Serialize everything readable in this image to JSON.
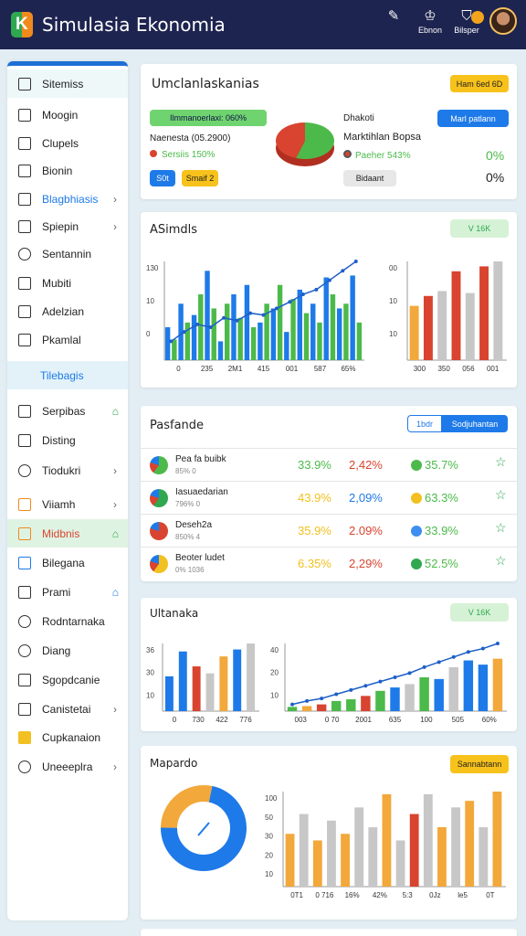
{
  "app": {
    "title": "Simulasia Ekonomia"
  },
  "topbar": {
    "items": [
      {
        "label": "",
        "icon": "puzzle-icon"
      },
      {
        "label": "Ebnon",
        "icon": "trophy-icon"
      },
      {
        "label": "Bilsper",
        "icon": "shield-icon"
      }
    ]
  },
  "sidebar": {
    "items": [
      {
        "label": "Sitemiss",
        "icon": "doc-icon",
        "active": true
      },
      {
        "label": "Moogin",
        "icon": "edit-icon"
      },
      {
        "label": "Clupels",
        "icon": "doc-icon"
      },
      {
        "label": "Bionin",
        "icon": "screen-icon"
      },
      {
        "label": "Blagbhiasis",
        "icon": "screen-icon",
        "arrow": true,
        "blue": true
      },
      {
        "label": "Spiepin",
        "icon": "grid-icon",
        "arrow": true
      },
      {
        "label": "Sentannin",
        "icon": "link-icon"
      },
      {
        "label": "Mubiti",
        "icon": "doc-icon"
      },
      {
        "label": "Adelzian",
        "icon": "doc-icon"
      },
      {
        "label": "Pkamlal",
        "icon": "doc-icon"
      },
      {
        "label": "Tilebagis",
        "icon": "none",
        "section": true
      },
      {
        "label": "Serpibas",
        "icon": "doc-icon",
        "house": true
      },
      {
        "label": "Disting",
        "icon": "doc-icon"
      },
      {
        "label": "Tiodukri",
        "icon": "link-icon",
        "arrow": true
      },
      {
        "label": "Viiamh",
        "icon": "orange-icon",
        "arrow": true
      },
      {
        "label": "Midbnis",
        "icon": "orange-icon",
        "house": true,
        "highlight": true
      },
      {
        "label": "Bilegana",
        "icon": "blue-icon"
      },
      {
        "label": "Prami",
        "icon": "doc-icon",
        "house": true
      },
      {
        "label": "Rodntarnaka",
        "icon": "search-icon"
      },
      {
        "label": "Diang",
        "icon": "gear-icon"
      },
      {
        "label": "Sgopdcanie",
        "icon": "doc-icon"
      },
      {
        "label": "Canistetai",
        "icon": "doc-icon",
        "arrow": true
      },
      {
        "label": "Cupkanaion",
        "icon": "yellow-icon"
      },
      {
        "label": "Uneeeplra",
        "icon": "heart-icon",
        "arrow": true
      }
    ]
  },
  "summary": {
    "title": "Umclanlaskanias",
    "button": "Ham 6ed 6D",
    "green_badge": "Ilmmanoerlaxi: 060%",
    "label1": "Naenesta (05.2900)",
    "label2": "Sersiis 150%",
    "btn1": "S0t",
    "btn2": "Smaif 2",
    "right_title": "Dhakoti",
    "right_button": "Marl patlann",
    "right_sub": "Marktihlan Bopsa",
    "right_line": "Paeher 543%",
    "stat1": "0%",
    "stat2": "0%",
    "pill": "Bidaant",
    "pie": [
      {
        "value": 55,
        "color": "#4cba4a"
      },
      {
        "value": 45,
        "color": "#d8442f"
      }
    ]
  },
  "asimdls": {
    "title": "ASimdls",
    "badge": "V 16K",
    "left_chart": {
      "type": "bar",
      "categories": [
        "0",
        "235",
        "2M1",
        "415",
        "001",
        "587",
        "65%"
      ],
      "series": [
        {
          "values": [
            35,
            60,
            48,
            95,
            20,
            70,
            80,
            40,
            55,
            30,
            75,
            60,
            88,
            55,
            90
          ],
          "color": "#1e7ae8"
        },
        {
          "values": [
            22,
            40,
            70,
            55,
            60,
            45,
            35,
            60,
            80,
            65,
            50,
            40,
            70,
            60,
            40
          ],
          "color": "#4cba4a"
        }
      ],
      "line": [
        20,
        30,
        38,
        35,
        45,
        42,
        50,
        48,
        55,
        62,
        70,
        75,
        85,
        95,
        105
      ],
      "ylabels": [
        "130",
        "10",
        "0"
      ]
    },
    "right_chart": {
      "type": "bar",
      "categories": [
        "300",
        "350",
        "056",
        "001"
      ],
      "values": [
        55,
        65,
        70,
        90,
        68,
        95,
        100
      ],
      "colors": [
        "#f2a83a",
        "#d8442f",
        "#c7c7c7",
        "#d8442f",
        "#c7c7c7",
        "#d8442f",
        "#c7c7c7"
      ],
      "ylabels": [
        "00",
        "10",
        "10"
      ]
    }
  },
  "pasfande": {
    "title": "Pasfande",
    "tab1": "1bdr",
    "tab2": "Sodjuhantan",
    "rows": [
      {
        "name": "Pea fa buibk",
        "sub": "85% 0",
        "v1": "33.9%",
        "v2": "2,42%",
        "v3": "35.7%",
        "dot": "#4cba4a",
        "icon": "#4cba4a",
        "c1": "#4cba4a",
        "c2": "#d8442f",
        "c3": "#4cba4a"
      },
      {
        "name": "Iasuaedarian",
        "sub": "796% 0",
        "v1": "43.9%",
        "v2": "2,09%",
        "v3": "63.3%",
        "dot": "#f2c020",
        "icon": "#2fa84f",
        "c1": "#f2c020",
        "c2": "#1e7ae8",
        "c3": "#4cba4a"
      },
      {
        "name": "Deseh2a",
        "sub": "850% 4",
        "v1": "35.9%",
        "v2": "2.09%",
        "v3": "33.9%",
        "dot": "#3d8ef0",
        "icon": "#d8442f",
        "c1": "#f2c020",
        "c2": "#d8442f",
        "c3": "#4cba4a"
      },
      {
        "name": "Beoter ludet",
        "sub": "0% 1036",
        "v1": "6.35%",
        "v2": "2,29%",
        "v3": "52.5%",
        "dot": "#2fa84f",
        "icon": "#f2c020",
        "c1": "#f2c020",
        "c2": "#d8442f",
        "c3": "#4cba4a"
      }
    ]
  },
  "ultanaka": {
    "title": "Ultanaka",
    "badge": "V 16K",
    "left_chart": {
      "type": "bar",
      "categories": [
        "0",
        "730",
        "422",
        "776"
      ],
      "values": [
        35,
        60,
        45,
        38,
        55,
        62,
        68
      ],
      "colors": [
        "#1e7ae8",
        "#1e7ae8",
        "#d8442f",
        "#c7c7c7",
        "#f2a83a",
        "#1e7ae8",
        "#c7c7c7"
      ],
      "ylabels": [
        "36",
        "30",
        "10"
      ]
    },
    "right_chart": {
      "type": "bar",
      "categories": [
        "003",
        "0 70",
        "2001",
        "635",
        "100",
        "505",
        "60%"
      ],
      "values": [
        5,
        6,
        8,
        12,
        14,
        18,
        24,
        28,
        32,
        40,
        38,
        52,
        60,
        55,
        62
      ],
      "colors": [
        "#4cba4a",
        "#f2a83a",
        "#d8442f",
        "#4cba4a",
        "#4cba4a",
        "#d8442f",
        "#4cba4a",
        "#1e7ae8",
        "#c7c7c7",
        "#4cba4a",
        "#1e7ae8",
        "#c7c7c7",
        "#1e7ae8",
        "#1e7ae8",
        "#f2a83a"
      ],
      "line": [
        8,
        12,
        15,
        20,
        25,
        30,
        35,
        40,
        45,
        52,
        58,
        64,
        70,
        74,
        80
      ],
      "ylabels": [
        "40",
        "20",
        "10"
      ]
    }
  },
  "mapardo": {
    "title": "Mapardo",
    "button": "Sannabtann",
    "donut": [
      {
        "value": 72,
        "color": "#1e7ae8"
      },
      {
        "value": 28,
        "color": "#f2a83a"
      }
    ],
    "chart": {
      "type": "bar",
      "categories": [
        "0T1",
        "0 716",
        "16%",
        "42%",
        "5:3",
        "0Jz",
        "le5",
        "0T"
      ],
      "values": [
        40,
        55,
        35,
        50,
        40,
        60,
        45,
        70,
        35,
        55,
        70,
        45,
        60,
        65,
        45,
        72
      ],
      "colors": [
        "#f2a83a",
        "#c7c7c7",
        "#f2a83a",
        "#c7c7c7",
        "#f2a83a",
        "#c7c7c7",
        "#c7c7c7",
        "#f2a83a",
        "#c7c7c7",
        "#d8442f",
        "#c7c7c7",
        "#f2a83a",
        "#c7c7c7",
        "#f2a83a",
        "#c7c7c7",
        "#f2a83a"
      ],
      "ylabels": [
        "100",
        "50",
        "30",
        "20",
        "10"
      ]
    }
  }
}
